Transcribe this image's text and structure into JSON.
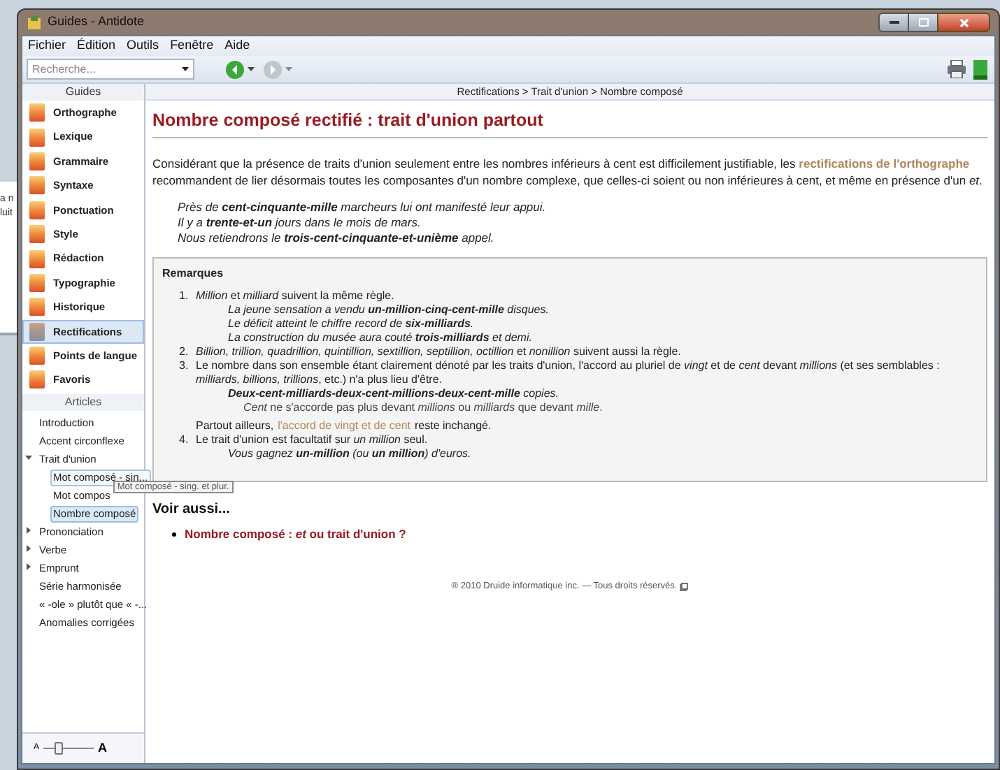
{
  "background_window": {
    "lines": [
      "a n",
      "luit"
    ]
  },
  "window": {
    "title": "Guides - Antidote"
  },
  "menu": [
    "Fichier",
    "Édition",
    "Outils",
    "Fenêtre",
    "Aide"
  ],
  "toolbar": {
    "search": {
      "placeholder": "Recherche..."
    },
    "back": {
      "disabled": false
    },
    "forward": {
      "disabled": true
    }
  },
  "sidebar": {
    "guides_header": "Guides",
    "guides": [
      {
        "label": "Orthographe",
        "selected": false
      },
      {
        "label": "Lexique",
        "selected": false
      },
      {
        "label": "Grammaire",
        "selected": false
      },
      {
        "label": "Syntaxe",
        "selected": false
      },
      {
        "label": "Ponctuation",
        "selected": false
      },
      {
        "label": "Style",
        "selected": false
      },
      {
        "label": "Rédaction",
        "selected": false
      },
      {
        "label": "Typographie",
        "selected": false
      },
      {
        "label": "Historique",
        "selected": false
      },
      {
        "label": "Rectifications",
        "selected": true
      },
      {
        "label": "Points de langue",
        "selected": false
      },
      {
        "label": "Favoris",
        "selected": false
      }
    ],
    "articles_header": "Articles",
    "articles": [
      {
        "label": "Introduction",
        "selected": false
      },
      {
        "label": "Accent circonflexe",
        "selected": false
      },
      {
        "label": "Trait d'union",
        "selected": false,
        "expanded": true,
        "children": [
          {
            "label": "Mot composé - sin...",
            "selected": false,
            "hovered": true
          },
          {
            "label": "Mot compos",
            "selected": false,
            "hovered": false,
            "tooltip": "Mot composé - sing. et plur."
          },
          {
            "label": "Nombre composé",
            "selected": true,
            "hovered": false
          }
        ]
      },
      {
        "label": "Prononciation",
        "selected": false,
        "expanded": false
      },
      {
        "label": "Verbe",
        "selected": false,
        "expanded": false
      },
      {
        "label": "Emprunt",
        "selected": false,
        "expanded": false
      },
      {
        "label": "Série harmonisée",
        "selected": false
      },
      {
        "label": "« -ole » plutôt que « -...",
        "selected": false
      },
      {
        "label": "Anomalies corrigées",
        "selected": false
      }
    ],
    "text_size": {
      "small": "A",
      "large": "A",
      "level": 0.3
    }
  },
  "breadcrumb": "Rectifications > Trait d'union > Nombre composé",
  "title": "Nombre composé rectifié : trait d'union partout",
  "intro": {
    "before": "Considérant que la présence de traits d'union seulement entre les nombres inférieurs à cent est difficilement justifiable, les",
    "link": "rectifications de l'orthographe",
    "after": "recommandent de lier désormais toutes les composantes d'un nombre complexe, que celles-ci soient ou non inférieures à cent, et même en présence d'un *et*."
  },
  "examples": [
    "Près de **cent-cinquante-mille** marcheurs lui ont manifesté leur appui.",
    "Il y a **trente-et-un** jours dans le mois de mars.",
    "Nous retiendrons le **trois-cent-cinquante-et-unième** appel."
  ],
  "remarks": {
    "title": "Remarques",
    "items": [
      {
        "kind": "item",
        "number": "1.",
        "text": "*Million* et *milliard* suivent la même règle."
      },
      {
        "kind": "example",
        "text": "La jeune sensation a vendu **un-million-cinq-cent-mille** disques."
      },
      {
        "kind": "example",
        "text": "Le déficit atteint le chiffre record de **six-milliards**."
      },
      {
        "kind": "example",
        "text": "La construction du musée aura couté **trois-milliards** et demi."
      },
      {
        "kind": "item",
        "number": "2.",
        "text": "*Billion, trillion, quadrillion, quintillion, sextillion, septillion, octillion* et *nonillion* suivent aussi la règle."
      },
      {
        "kind": "item",
        "number": "3.",
        "text": "Le nombre dans son ensemble étant clairement dénoté par les traits d'union, l'accord au pluriel de *vingt* et de *cent* devant *millions* (et ses semblables : *milliards, billions, trillions*, etc.) n'a plus lieu d'être."
      },
      {
        "kind": "example",
        "text": "**Deux-cent-milliards-deux-cent-millions-deux-cent-mille** copies."
      },
      {
        "kind": "note",
        "text": "*Cent* ne s'accorde pas plus devant *millions* ou *milliards* que devant *mille*."
      },
      {
        "kind": "link_line",
        "before": "Partout ailleurs,",
        "link": "l'accord de vingt et de cent",
        "after": "reste inchangé."
      },
      {
        "kind": "item",
        "number": "4.",
        "text": "Le trait d'union est facultatif sur *un million* seul."
      },
      {
        "kind": "example",
        "text": "Vous gagnez **un-million** (ou **un million**) d'euros."
      }
    ]
  },
  "see_also": {
    "title": "Voir aussi...",
    "links": [
      "Nombre composé : *et* ou trait d'union ?"
    ]
  },
  "footer": "® 2010 Druide informatique inc. — Tous droits réservés."
}
